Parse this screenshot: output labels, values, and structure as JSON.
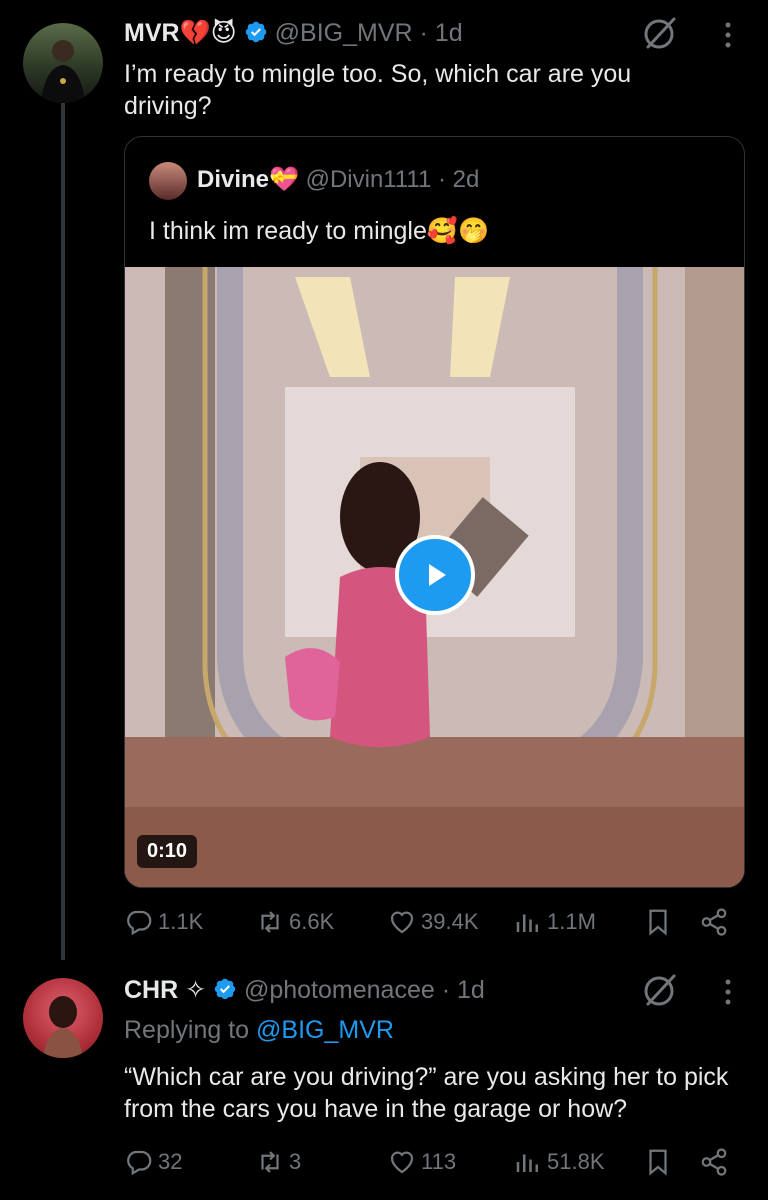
{
  "tweet1": {
    "display_name": "MVR💔😈",
    "handle": "@BIG_MVR",
    "time": "· 1d",
    "text": "I’m ready to mingle too. So, which car are you driving?",
    "quote": {
      "display_name": "Divine💝",
      "handle": "@Divin1111",
      "time": "· 2d",
      "text": "I think im ready to mingle🥰🤭",
      "video_duration": "0:10"
    },
    "stats": {
      "replies": "1.1K",
      "reposts": "6.6K",
      "likes": "39.4K",
      "views": "1.1M"
    }
  },
  "tweet2": {
    "display_name": "CHR ✧",
    "handle": "@photomenacee",
    "time": "· 1d",
    "replying_label": "Replying to",
    "replying_handle": "@BIG_MVR",
    "text": "“Which car are you driving?” are you asking her to pick from the cars you have in the garage or how?",
    "stats": {
      "replies": "32",
      "reposts": "3",
      "likes": "113",
      "views": "51.8K"
    }
  },
  "colors": {
    "accent": "#1d9bf0",
    "muted": "#71767b",
    "text": "#e7e9ea",
    "background": "#000000"
  },
  "icons": [
    "grok-icon",
    "more-icon",
    "verified-badge-icon",
    "reply-icon",
    "repost-icon",
    "like-icon",
    "views-icon",
    "bookmark-icon",
    "share-icon",
    "play-icon"
  ]
}
